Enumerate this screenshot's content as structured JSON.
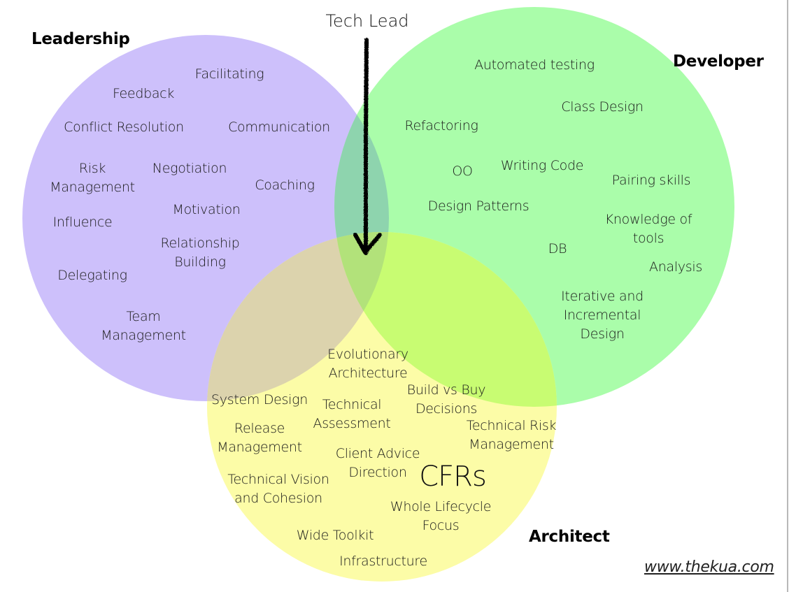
{
  "title": "Tech Lead",
  "footer_link": "www.thekua.com",
  "colors": {
    "leadership": "#CDC0FB",
    "developer": "#AAFDAA",
    "architect": "#FCFCA7",
    "leadership_developer_overlap": "#8ED4AE",
    "leadership_architect_overlap": "#DCD3AD",
    "developer_architect_overlap": "#C8FC72",
    "all_three_overlap": "#B2E27A",
    "arrow": "#000000"
  },
  "sets": {
    "leadership": {
      "name": "Leadership",
      "items": [
        "Facilitating",
        "Feedback",
        "Conflict Resolution",
        "Communication",
        "Risk\nManagement",
        "Negotiation",
        "Coaching",
        "Motivation",
        "Influence",
        "Relationship\nBuilding",
        "Delegating",
        "Team\nManagement"
      ]
    },
    "developer": {
      "name": "Developer",
      "items": [
        "Automated testing",
        "Class Design",
        "Refactoring",
        "OO",
        "Writing Code",
        "Pairing skills",
        "Design Patterns",
        "Knowledge of\ntools",
        "DB",
        "Analysis",
        "Iterative and\nIncremental\nDesign"
      ]
    },
    "architect": {
      "name": "Architect",
      "items": [
        "Evolutionary\nArchitecture",
        "Build vs Buy\nDecisions",
        "System Design",
        "Technical\nAssessment",
        "Technical Risk\nManagement",
        "Release\nManagement",
        "Client Advice\nDirection",
        "CFRs",
        "Technical Vision\nand Cohesion",
        "Whole Lifecycle\nFocus",
        "Wide Toolkit",
        "Infrastructure"
      ]
    }
  },
  "arrow": {
    "label": "Tech Lead",
    "points_to": "intersection of Leadership, Developer and Architect"
  }
}
